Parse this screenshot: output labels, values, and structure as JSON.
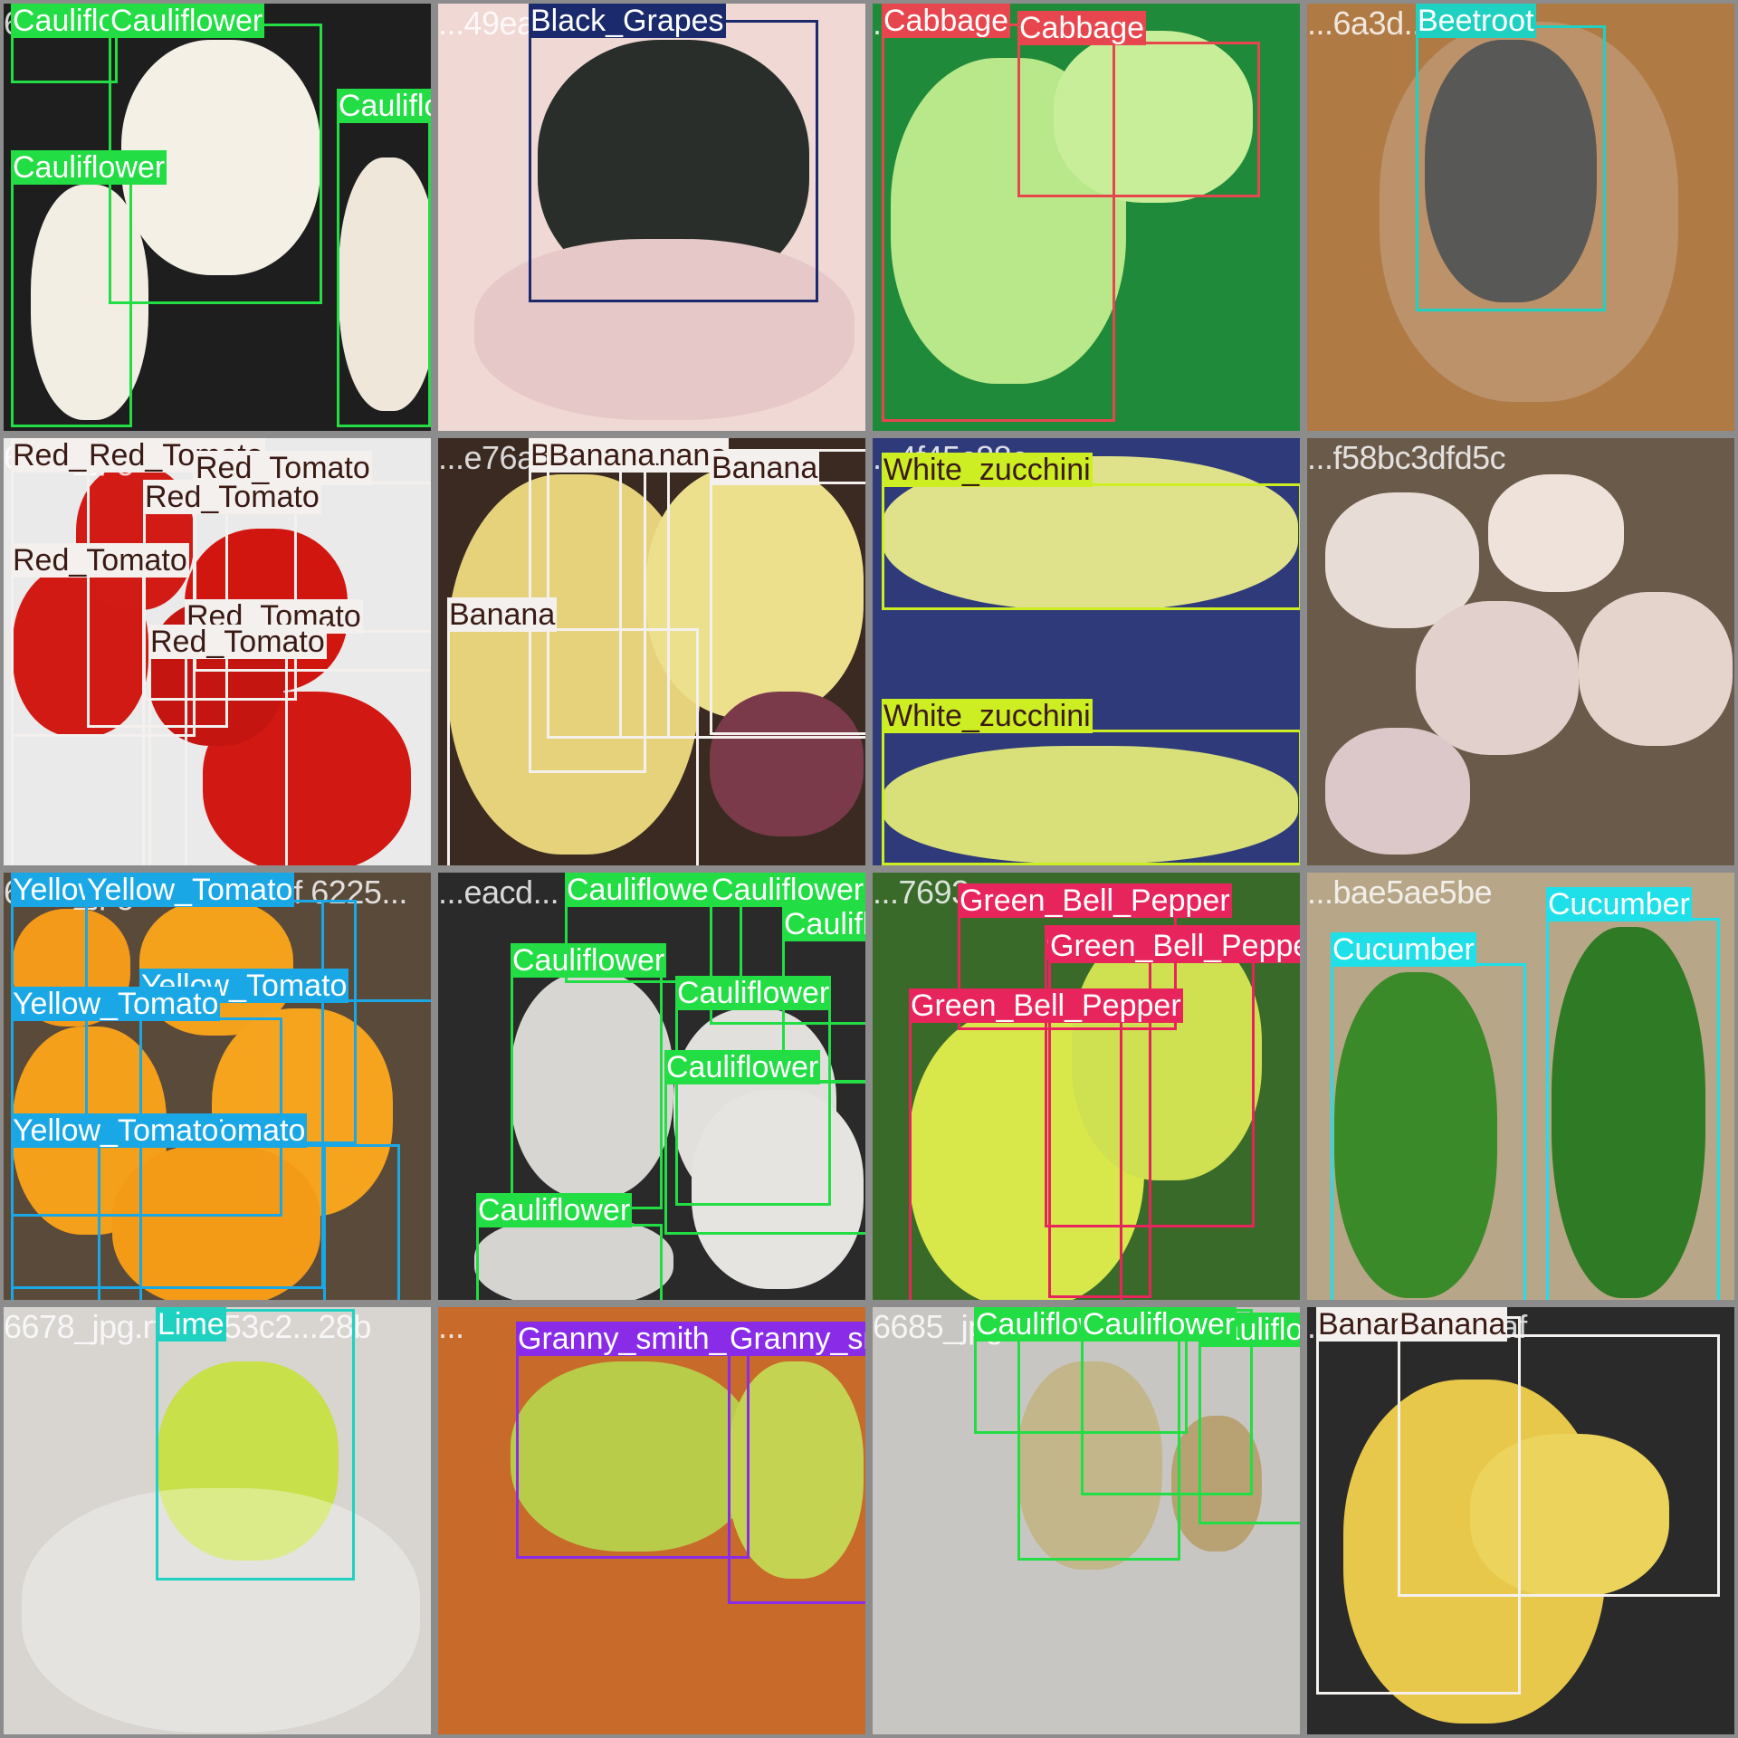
{
  "image": {
    "width": 1920,
    "height": 1920,
    "description_kind": "object-detection-mosaic"
  },
  "tiles": [
    {
      "filename": "6155d649c611e...",
      "background": "#1e1e1e",
      "objects": [
        {
          "label": "Cauliflower",
          "color": "#22dd44"
        },
        {
          "label": "Cauliflower",
          "color": "#22dd44"
        },
        {
          "label": "Cauliflower",
          "color": "#22dd44"
        },
        {
          "label": "Cauliflower",
          "color": "#22dd44"
        }
      ]
    },
    {
      "filename": "...49ea96...",
      "background": "#f0d8d4",
      "objects": [
        {
          "label": "Black_Grapes",
          "color": "#1a2a6c"
        }
      ]
    },
    {
      "filename": "...2d5",
      "background": "#1f8a3a",
      "objects": [
        {
          "label": "Cabbage",
          "color": "#e8464e"
        },
        {
          "label": "Cabbage",
          "color": "#e8464e"
        }
      ]
    },
    {
      "filename": "...6a3d...",
      "background": "#b07a44",
      "objects": [
        {
          "label": "Beetroot",
          "color": "#1fd1c1"
        }
      ]
    },
    {
      "filename": "6696_jpg.rf...",
      "background": "#eaeaea",
      "objects": [
        {
          "label": "Red_Tomato",
          "color": "#f3f0ee"
        },
        {
          "label": "Red_Tomato",
          "color": "#f3f0ee"
        },
        {
          "label": "Red_Tomato",
          "color": "#f3f0ee"
        },
        {
          "label": "Red_Tomato",
          "color": "#f3f0ee"
        },
        {
          "label": "Red_Tomato",
          "color": "#f3f0ee"
        },
        {
          "label": "Red_Tomato",
          "color": "#f3f0ee"
        },
        {
          "label": "Red_Tomato",
          "color": "#f3f0ee"
        }
      ]
    },
    {
      "filename": "...e76a83...",
      "background": "#3a2a22",
      "objects": [
        {
          "label": "Banana",
          "color": "#f3f0ee"
        },
        {
          "label": "Banana",
          "color": "#f3f0ee"
        },
        {
          "label": "Banana",
          "color": "#f3f0ee"
        },
        {
          "label": "Banana",
          "color": "#f3f0ee"
        },
        {
          "label": "Banana",
          "color": "#f3f0ee"
        }
      ]
    },
    {
      "filename": "...4f45c88c...",
      "background": "#2e3a7a",
      "objects": [
        {
          "label": "White_zucchini",
          "color": "#ccee22"
        },
        {
          "label": "White_zucchini",
          "color": "#ccee22"
        }
      ]
    },
    {
      "filename": "...f58bc3dfd5c",
      "background": "#6a5a4a",
      "objects": []
    },
    {
      "filename": "6695_jpg.rf.7ab e2faf 6225...",
      "background": "#5a4a3a",
      "objects": [
        {
          "label": "Yellow_Tomato",
          "color": "#1aa7e6"
        },
        {
          "label": "Yellow_Tomato",
          "color": "#1aa7e6"
        },
        {
          "label": "Yellow_Tomato",
          "color": "#1aa7e6"
        },
        {
          "label": "Yellow_Tomato",
          "color": "#1aa7e6"
        },
        {
          "label": "Yellow_Tomato",
          "color": "#1aa7e6"
        },
        {
          "label": "Yellow_Tomato",
          "color": "#1aa7e6"
        }
      ]
    },
    {
      "filename": "...eacd...",
      "background": "#2a2a2a",
      "objects": [
        {
          "label": "Cauliflower",
          "color": "#22dd44"
        },
        {
          "label": "Cauliflower",
          "color": "#22dd44"
        },
        {
          "label": "Cauliflower",
          "color": "#22dd44"
        },
        {
          "label": "Cauliflower",
          "color": "#22dd44"
        },
        {
          "label": "Cauliflower",
          "color": "#22dd44"
        },
        {
          "label": "Cauliflower",
          "color": "#22dd44"
        },
        {
          "label": "Cauliflower",
          "color": "#22dd44"
        }
      ]
    },
    {
      "filename": "...7693...",
      "background": "#3a6a2a",
      "objects": [
        {
          "label": "Green_Bell_Pepper",
          "color": "#e8245c"
        },
        {
          "label": "Green_Bell_Pepper",
          "color": "#e8245c"
        },
        {
          "label": "Green_Bell_Pepper",
          "color": "#e8245c"
        },
        {
          "label": "Green_Bell_Pepper",
          "color": "#e8245c"
        }
      ]
    },
    {
      "filename": "...bae5ae5be",
      "background": "#b8a688",
      "objects": [
        {
          "label": "Cucumber",
          "color": "#1fe0e8"
        },
        {
          "label": "Cucumber",
          "color": "#1fe0e8"
        }
      ]
    },
    {
      "filename": "6678_jpg.rf.67b53c2...28b",
      "background": "#d8d4d0",
      "objects": [
        {
          "label": "Lime",
          "color": "#1fd1c1"
        }
      ]
    },
    {
      "filename": "...",
      "background": "#c86a2a",
      "objects": [
        {
          "label": "Granny_smith_apple",
          "color": "#8a2be8"
        },
        {
          "label": "Granny_smith_apple",
          "color": "#8a2be8"
        }
      ]
    },
    {
      "filename": "6685_jpg.rf...",
      "background": "#c8c6c2",
      "objects": [
        {
          "label": "Cauliflower",
          "color": "#22dd44"
        },
        {
          "label": "Cauliflower",
          "color": "#22dd44"
        },
        {
          "label": "Cauliflower",
          "color": "#22dd44"
        },
        {
          "label": "Cauliflower",
          "color": "#22dd44"
        }
      ]
    },
    {
      "filename": "...f7be81729aaf",
      "background": "#2a2a2a",
      "objects": [
        {
          "label": "Banana",
          "color": "#f3f0ee"
        },
        {
          "label": "Banana",
          "color": "#f3f0ee"
        }
      ]
    }
  ]
}
